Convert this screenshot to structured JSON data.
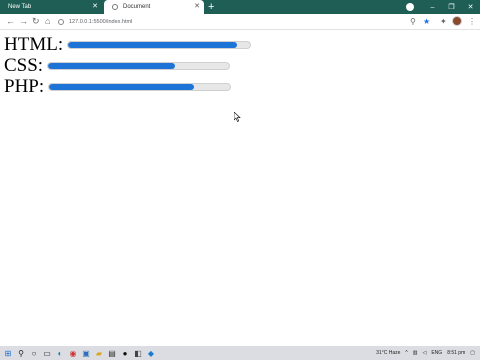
{
  "browser": {
    "tabs": [
      {
        "label": "New Tab",
        "active": false
      },
      {
        "label": "Document",
        "active": true
      }
    ],
    "url": "127.0.0.1:5500/index.html"
  },
  "skills": [
    {
      "label": "HTML:",
      "progress": 0.93
    },
    {
      "label": "CSS:",
      "progress": 0.7
    },
    {
      "label": "PHP:",
      "progress": 0.8
    }
  ],
  "taskbar": {
    "weather": "31°C  Haze",
    "language": "ENG",
    "time": "8:51 pm"
  },
  "colors": {
    "tabstrip": "#1f5e55",
    "progress_fill": "#1e74d6",
    "progress_track": "#e7e7e7"
  }
}
